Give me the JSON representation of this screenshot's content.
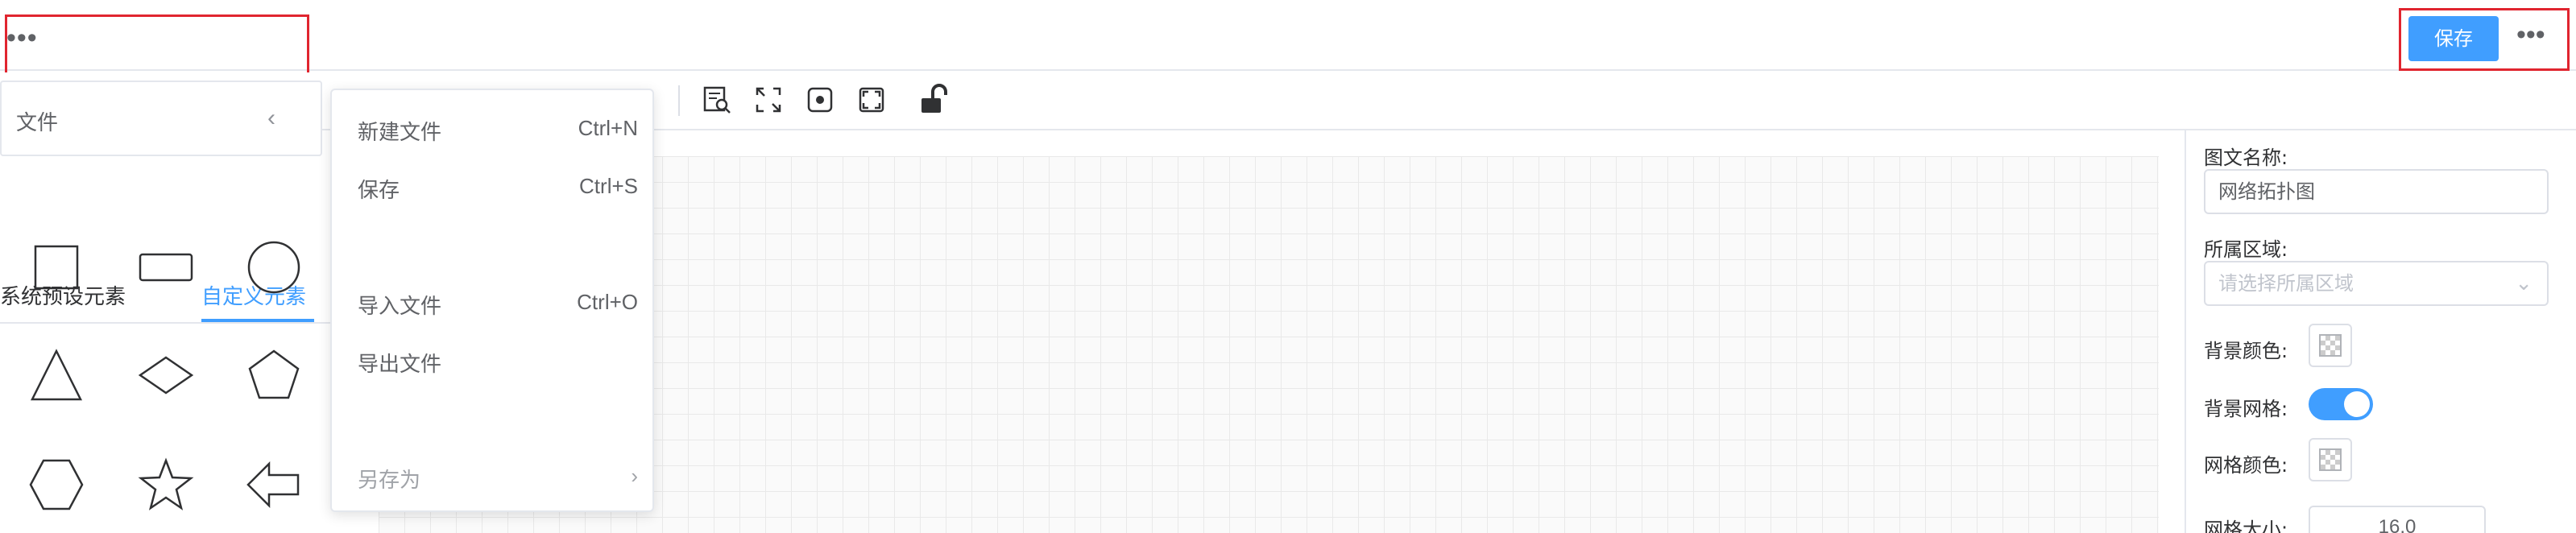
{
  "header": {
    "more_left": "•••",
    "save_label": "保存",
    "more_right": "•••"
  },
  "file_menu": {
    "label": "文件",
    "chevron": "‹"
  },
  "palette": {
    "tabs": [
      "系统预设元素",
      "自定义元素"
    ],
    "active_tab": "自定义元素",
    "shapes": [
      "square",
      "rectangle",
      "circle",
      "triangle",
      "diamond",
      "pentagon",
      "hexagon",
      "star",
      "left-arrow"
    ]
  },
  "submenu": {
    "items": [
      {
        "label": "新建文件",
        "shortcut": "Ctrl+N",
        "disabled": false
      },
      {
        "label": "保存",
        "shortcut": "Ctrl+S",
        "disabled": false
      },
      {
        "label": "导入文件",
        "shortcut": "Ctrl+O",
        "disabled": false
      },
      {
        "label": "导出文件",
        "shortcut": "",
        "disabled": false
      },
      {
        "label": "另存为",
        "shortcut": "›",
        "disabled": true
      }
    ]
  },
  "properties": {
    "name_label": "图文名称:",
    "name_value": "网络拓扑图",
    "region_label": "所属区域:",
    "region_placeholder": "请选择所属区域",
    "bg_color_label": "背景颜色:",
    "bg_grid_label": "背景网格:",
    "bg_grid_on": true,
    "grid_color_label": "网格颜色:",
    "grid_size_label": "网格大小:",
    "grid_size_value": "16.0"
  },
  "colors": {
    "accent": "#409eff",
    "highlight": "#e0252f"
  }
}
